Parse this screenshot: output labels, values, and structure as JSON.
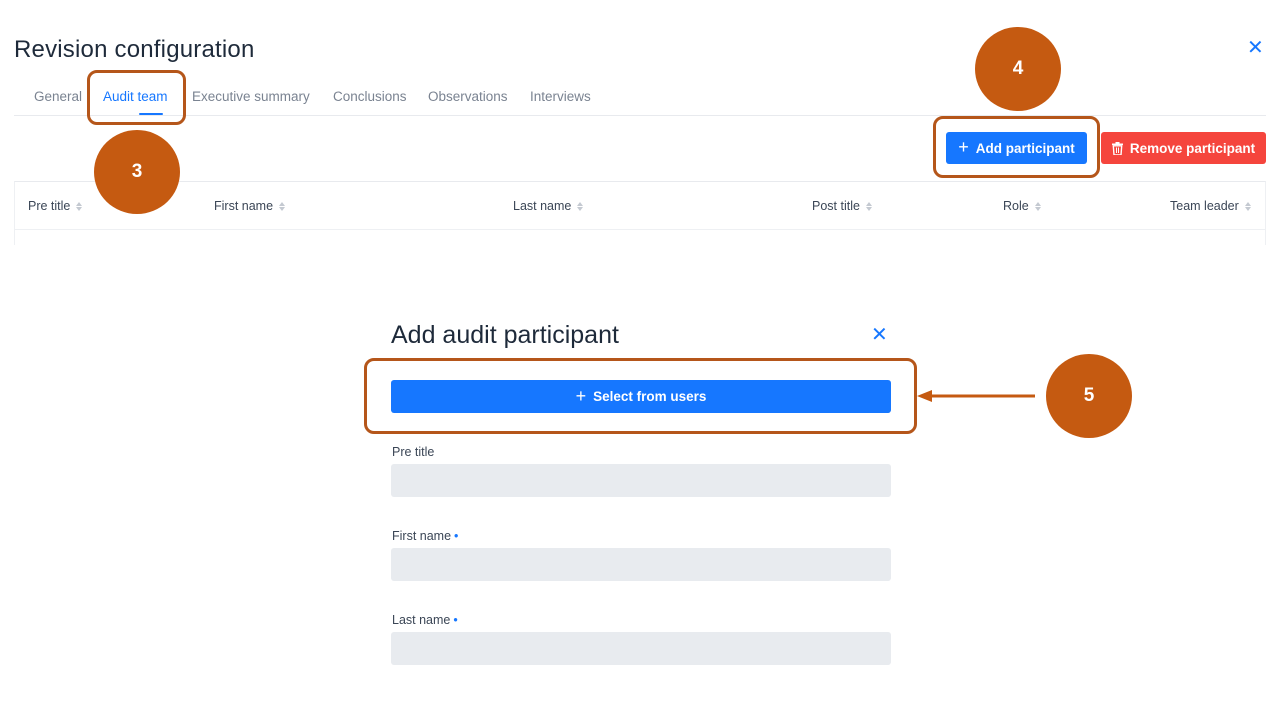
{
  "page": {
    "title": "Revision configuration"
  },
  "tabs": [
    {
      "label": "General"
    },
    {
      "label": "Audit team"
    },
    {
      "label": "Executive summary"
    },
    {
      "label": "Conclusions"
    },
    {
      "label": "Observations"
    },
    {
      "label": "Interviews"
    }
  ],
  "active_tab": "Audit team",
  "toolbar": {
    "add_label": "Add participant",
    "remove_label": "Remove participant"
  },
  "table": {
    "columns": [
      "Pre title",
      "First name",
      "Last name",
      "Post title",
      "Role",
      "Team leader"
    ],
    "rows": []
  },
  "modal": {
    "title": "Add audit participant",
    "select_label": "Select from users",
    "fields": [
      {
        "label": "Pre title",
        "required": false,
        "value": ""
      },
      {
        "label": "First name",
        "required": true,
        "value": ""
      },
      {
        "label": "Last name",
        "required": true,
        "value": ""
      }
    ],
    "required_marker": "•"
  },
  "annotations": [
    {
      "number": "3"
    },
    {
      "number": "4"
    },
    {
      "number": "5"
    }
  ],
  "colors": {
    "primary": "#1677ff",
    "danger": "#f5453d",
    "annotation": "#c55a11",
    "annotation_border": "#b5561a",
    "input_bg": "#e8ebef"
  },
  "icons": {
    "close": "close-icon",
    "plus": "plus-icon",
    "trash": "trash-icon",
    "sort": "sort-icon"
  }
}
